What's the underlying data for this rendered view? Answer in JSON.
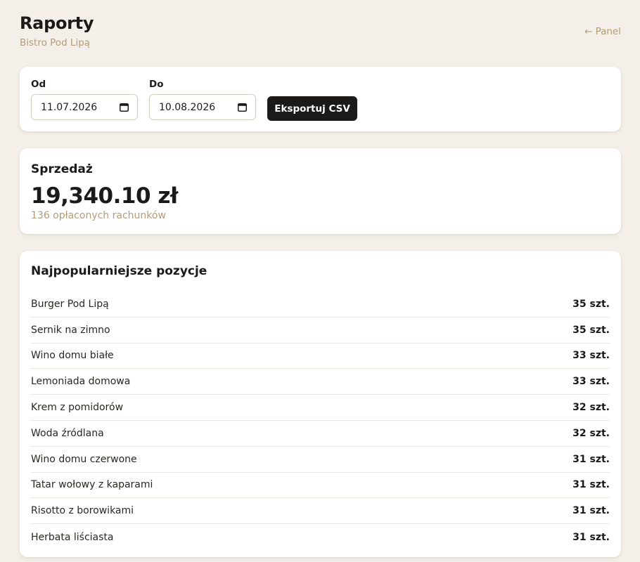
{
  "header": {
    "title": "Raporty",
    "subtitle": "Bistro Pod Lipą",
    "back_link": "← Panel"
  },
  "filters": {
    "from_label": "Od",
    "from_value": "11.07.2026",
    "to_label": "Do",
    "to_value": "10.08.2026",
    "export_label": "Eksportuj CSV",
    "calendar_icon": "calendar-icon"
  },
  "sales": {
    "heading": "Sprzedaż",
    "total": "19,340.10 zł",
    "note": "136 opłaconych rachunków"
  },
  "popular": {
    "heading": "Najpopularniejsze pozycje",
    "items": [
      {
        "name": "Burger Pod Lipą",
        "qty": "35 szt."
      },
      {
        "name": "Sernik na zimno",
        "qty": "35 szt."
      },
      {
        "name": "Wino domu białe",
        "qty": "33 szt."
      },
      {
        "name": "Lemoniada domowa",
        "qty": "33 szt."
      },
      {
        "name": "Krem z pomidorów",
        "qty": "32 szt."
      },
      {
        "name": "Woda źródlana",
        "qty": "32 szt."
      },
      {
        "name": "Wino domu czerwone",
        "qty": "31 szt."
      },
      {
        "name": "Tatar wołowy z kaparami",
        "qty": "31 szt."
      },
      {
        "name": "Risotto z borowikami",
        "qty": "31 szt."
      },
      {
        "name": "Herbata liściasta",
        "qty": "31 szt."
      }
    ]
  },
  "colors": {
    "background": "#f4efe8",
    "accent_muted": "#b39b78",
    "button_dark": "#1c1a18"
  }
}
